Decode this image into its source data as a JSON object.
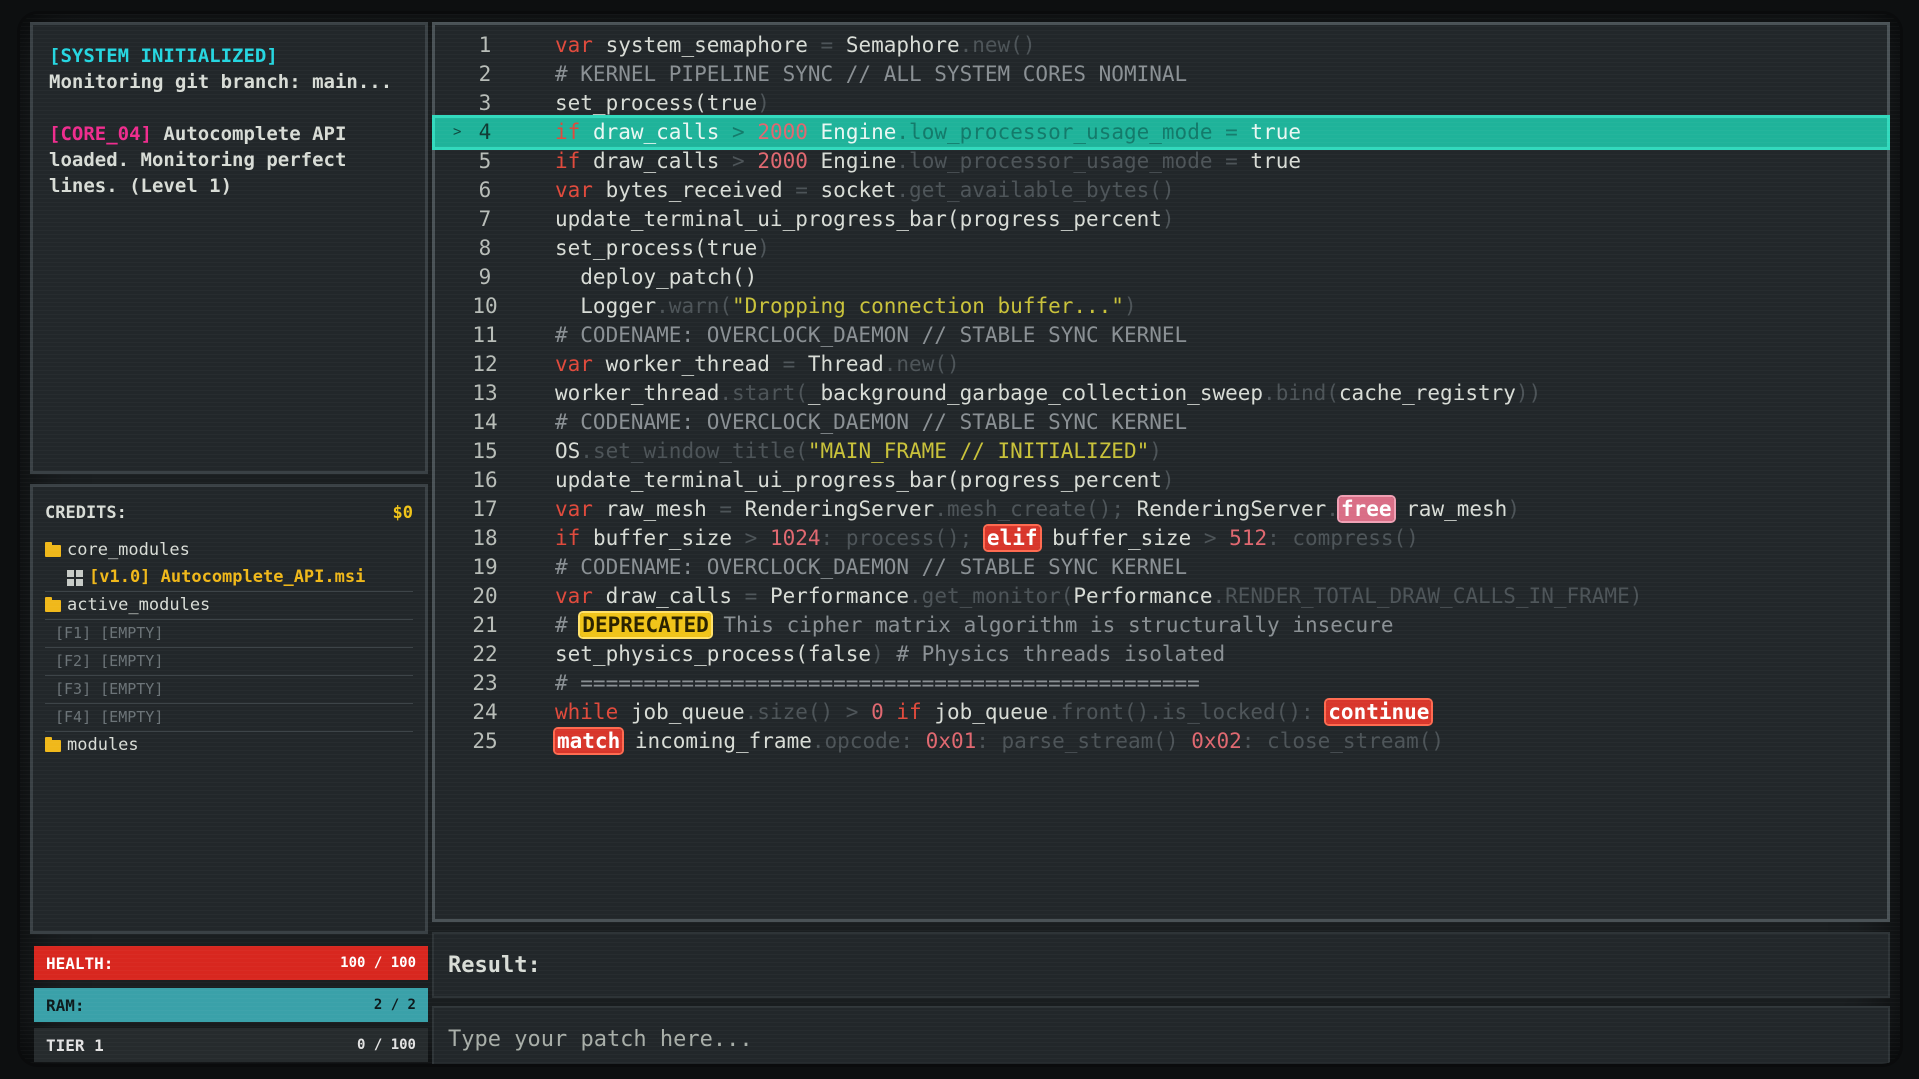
{
  "log": [
    {
      "tag": "[SYSTEM INITIALIZED]",
      "text": "Monitoring git branch: main..."
    },
    {
      "tag": "[CORE_04]",
      "text": "Autocomplete API loaded. Monitoring perfect lines. (Level 1)"
    }
  ],
  "files": {
    "header": "CREDITS:",
    "credits": "$0",
    "folder1": "core_modules",
    "api_file": "[v1.0] Autocomplete_API.msi",
    "folder2": "active_modules",
    "slots": [
      "[F1] [EMPTY]",
      "[F2] [EMPTY]",
      "[F3] [EMPTY]",
      "[F4] [EMPTY]"
    ],
    "folder3": "modules"
  },
  "stats": {
    "health_label": "HEALTH:",
    "health_value": "100 / 100",
    "health_fraction": 1.0,
    "ram_label": "RAM:",
    "ram_value": "2 / 2",
    "ram_fraction": 1.0,
    "tier_label": "TIER 1",
    "tier_value": "0 / 100",
    "tier_fraction": 0.0
  },
  "editor": {
    "highlighted_line": 4,
    "line_numbers": [
      "1",
      "2",
      "3",
      "4",
      "5",
      "6",
      "7",
      "8",
      "9",
      "10",
      "11",
      "12",
      "13",
      "14",
      "15",
      "16",
      "17",
      "18",
      "19",
      "20",
      "21",
      "22",
      "23",
      "24",
      "25"
    ]
  },
  "code": {
    "l1": {
      "a": "var",
      "b": " system_semaphore ",
      "c": "=",
      "d": " Semaphore",
      "e": ".new()"
    },
    "l2": "# KERNEL PIPELINE SYNC // ALL SYSTEM CORES NOMINAL",
    "l3": {
      "a": "set_process(true",
      "b": ")"
    },
    "l4": {
      "a": "if",
      "b": " draw_calls ",
      "c": ">",
      "d": " 2000",
      "e": " Engine",
      "f": ".low_processor_usage_mode = ",
      "g": "true"
    },
    "l5": {
      "a": "if",
      "b": " draw_calls ",
      "c": ">",
      "d": " 2000",
      "e": " Engine",
      "f": ".low_processor_usage_mode = ",
      "g": "true"
    },
    "l6": {
      "a": "var",
      "b": " bytes_received ",
      "c": "=",
      "d": " socket",
      "e": ".get_available_bytes()"
    },
    "l7": {
      "a": "update_terminal_ui_progress_bar(progress_percent",
      "b": ")"
    },
    "l8": {
      "a": "set_process(true",
      "b": ")"
    },
    "l9": "  deploy_patch()",
    "l10": {
      "a": "  Logger",
      "b": ".warn(",
      "c": "\"Dropping connection buffer...\"",
      "d": ")"
    },
    "l11": "# CODENAME: OVERCLOCK_DAEMON // STABLE SYNC KERNEL",
    "l12": {
      "a": "var",
      "b": " worker_thread ",
      "c": "=",
      "d": " Thread",
      "e": ".new()"
    },
    "l13": {
      "a": "worker_thread",
      "b": ".start(",
      "c": "_background_garbage_collection_sweep",
      "d": ".bind(",
      "e": "cache_registry",
      "f": "))"
    },
    "l14": "# CODENAME: OVERCLOCK_DAEMON // STABLE SYNC KERNEL",
    "l15": {
      "a": "OS",
      "b": ".set_window_title(",
      "c": "\"MAIN_FRAME // INITIALIZED\"",
      "d": ")"
    },
    "l16": {
      "a": "update_terminal_ui_progress_bar(progress_percent",
      "b": ")"
    },
    "l17": {
      "a": "var",
      "b": " raw_mesh ",
      "c": "=",
      "d": " RenderingServer",
      "e": ".mesh_create(); ",
      "f": "RenderingServer",
      "g": ".",
      "h": "free",
      "i": " raw_mesh",
      "j": ")"
    },
    "l18": {
      "a": "if",
      "b": " buffer_size ",
      "c": ">",
      "d": " 1024",
      "e": ": process(); ",
      "f": "elif",
      "g": " buffer_size ",
      "h": ">",
      "i": " 512",
      "j": ": compress()"
    },
    "l19": "# CODENAME: OVERCLOCK_DAEMON // STABLE SYNC KERNEL",
    "l20": {
      "a": "var",
      "b": " draw_calls ",
      "c": "=",
      "d": " Performance",
      "e": ".get_monitor(",
      "f": "Performance",
      "g": ".RENDER_TOTAL_DRAW_CALLS_IN_FRAME)"
    },
    "l21": {
      "a": "# ",
      "b": "DEPRECATED",
      "c": " This cipher matrix algorithm is structurally insecure"
    },
    "l22": {
      "a": "set_physics_process(false",
      "b": ") ",
      "c": "# Physics threads isolated"
    },
    "l23": "# =================================================",
    "l24": {
      "a": "while",
      "b": " job_queue",
      "c": ".size() > ",
      "d": "0",
      "e": " if",
      "f": " job_queue",
      "g": ".front().is_locked(): ",
      "h": "continue"
    },
    "l25": {
      "a": "match",
      "b": " incoming_frame",
      "c": ".opcode: ",
      "d": "0x01",
      "e": ": parse_stream() ",
      "f": "0x02",
      "g": ": close_stream()"
    }
  },
  "result_label": "Result:",
  "patch_placeholder": "Type your patch here..."
}
